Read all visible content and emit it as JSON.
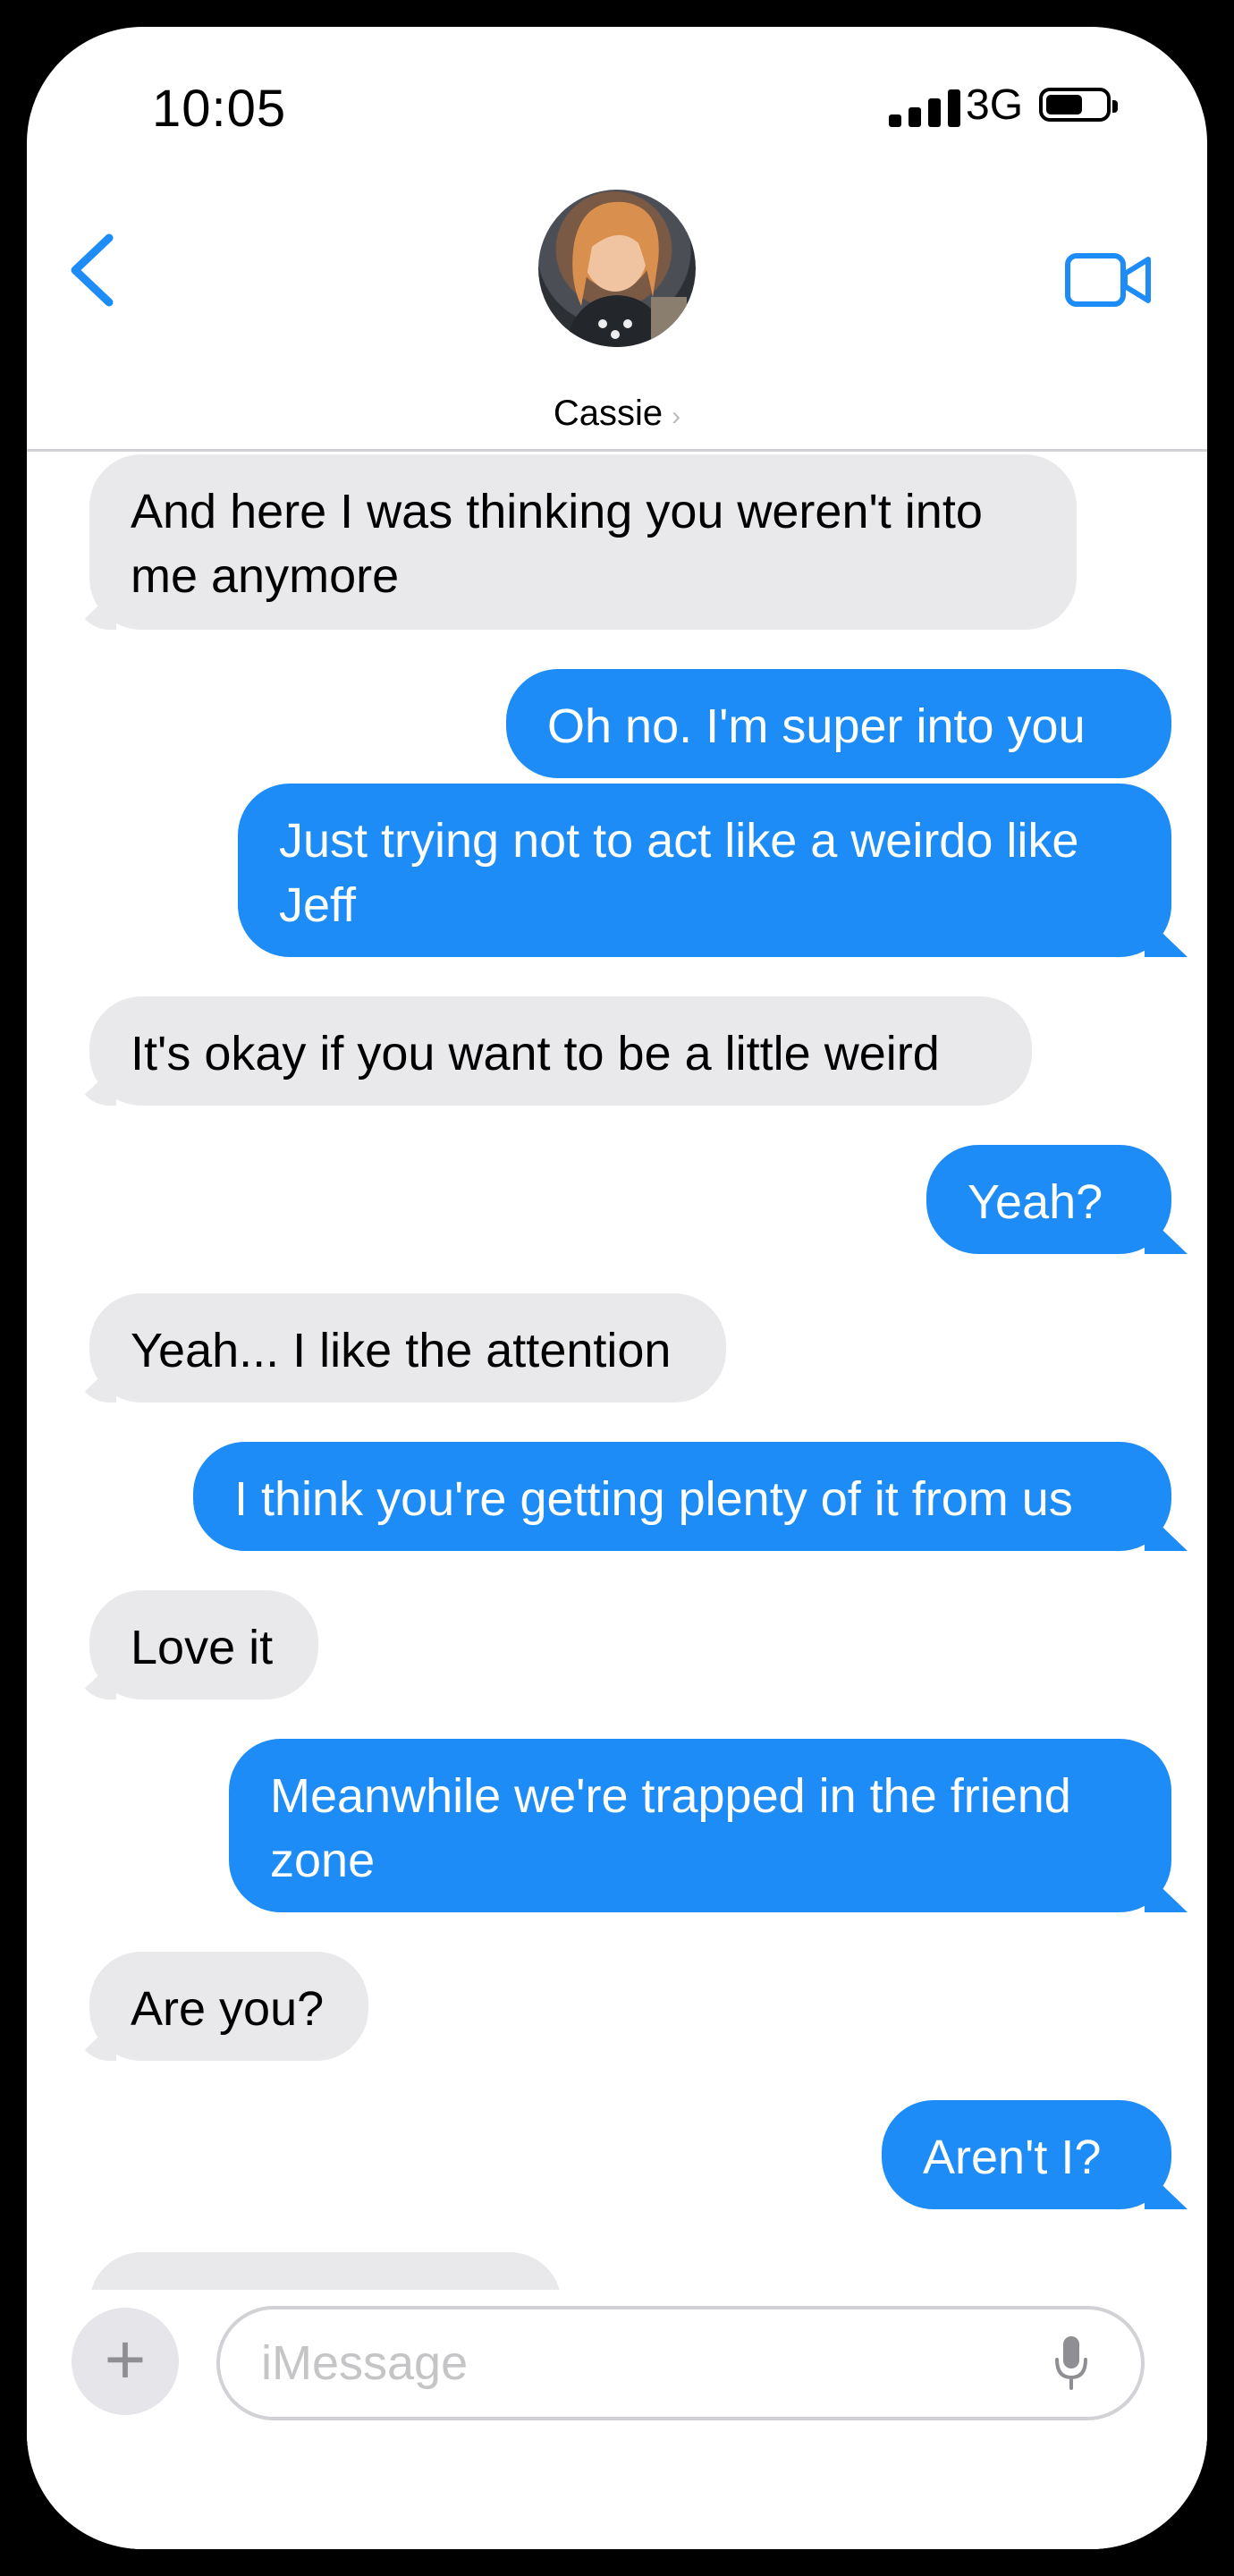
{
  "status": {
    "time": "10:05",
    "network": "3G"
  },
  "header": {
    "contact_name": "Cassie",
    "chevron": "›"
  },
  "messages": [
    {
      "from": "them",
      "text": "And here I was thinking you weren't into me anymore"
    },
    {
      "from": "me",
      "text": "Oh no.  I'm super into you"
    },
    {
      "from": "me",
      "text": "Just trying not to act like a weirdo like Jeff"
    },
    {
      "from": "them",
      "text": "It's okay if you want to be a little weird"
    },
    {
      "from": "me",
      "text": "Yeah?"
    },
    {
      "from": "them",
      "text": "Yeah... I like the attention"
    },
    {
      "from": "me",
      "text": "I think you're getting plenty of it from us"
    },
    {
      "from": "them",
      "text": "Love it"
    },
    {
      "from": "me",
      "text": "Meanwhile we're trapped in the friend zone"
    },
    {
      "from": "them",
      "text": "Are you?"
    },
    {
      "from": "me",
      "text": "Aren't I?"
    }
  ],
  "composer": {
    "plus": "+",
    "placeholder": "iMessage"
  },
  "icons": {
    "back": "chevron-left-icon",
    "video": "video-camera-icon",
    "mic": "microphone-icon",
    "plus": "plus-icon"
  },
  "colors": {
    "accent": "#1e8cf6",
    "incoming": "#e9e9eb",
    "outgoing": "#1e8cf6"
  }
}
